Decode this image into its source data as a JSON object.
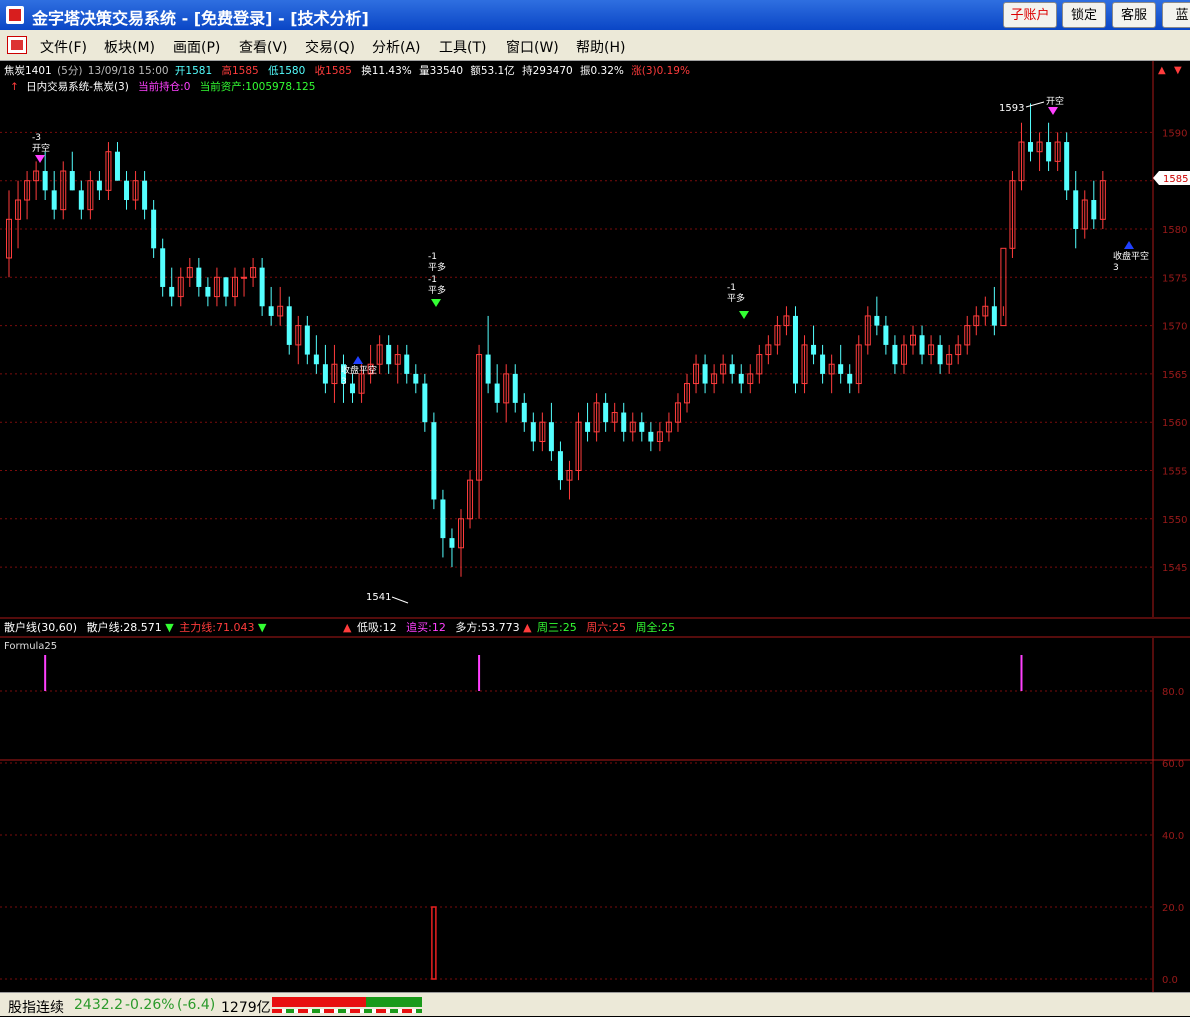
{
  "window": {
    "title": "金字塔决策交易系统 - [免费登录] - [技术分析]",
    "buttons": [
      "子账户",
      "锁定",
      "客服",
      "蓝"
    ]
  },
  "menu": {
    "items": [
      "文件(F)",
      "板块(M)",
      "画面(P)",
      "查看(V)",
      "交易(Q)",
      "分析(A)",
      "工具(T)",
      "窗口(W)",
      "帮助(H)"
    ]
  },
  "quote": {
    "symbol": "焦炭1401",
    "period": "(5分)",
    "datetime": "13/09/18 15:00",
    "open": "开1581",
    "high": "高1585",
    "low": "低1580",
    "close": "收1585",
    "turnover": "换11.43%",
    "volume": "量33540",
    "amount": "额53.1亿",
    "hold": "持293470",
    "amplitude": "振0.32%",
    "change": "涨(3)0.19%",
    "system": "日内交易系统-焦炭(3)",
    "position": "当前持仓:0",
    "assets": "当前资产:1005978.125",
    "current_price": "1585"
  },
  "axis": {
    "price_ticks": [
      "1590",
      "1585",
      "1580",
      "1575",
      "1570",
      "1565",
      "1560",
      "1555",
      "1550",
      "1545"
    ],
    "ind_ticks": [
      "80.0",
      "60.0",
      "40.0",
      "20.0",
      "0.0"
    ]
  },
  "markers": {
    "open_short_label": "开空",
    "open_short_count": "-3",
    "cover_label": "平多",
    "cover_count": "-1",
    "close_label": "收盘平空",
    "close_count": "3",
    "low_label": "1541",
    "high_label": "1593"
  },
  "indicator": {
    "name": "散户线(30,60)",
    "retail": "散户线:28.571",
    "main_force": "主力线:71.043",
    "low_buy": "低吸:12",
    "chase": "追买:12",
    "bull": "多方:53.773",
    "wed": "周三:25",
    "sat": "周六:25",
    "all": "周全:25"
  },
  "formula": {
    "name": "Formula25"
  },
  "status": {
    "index_name": "股指连续",
    "index_value": "2432.2",
    "index_change": "-0.26%",
    "index_delta": "(-6.4)",
    "index_volume": "1279亿"
  },
  "colors": {
    "up": "#ff3c3c",
    "down": "#54ffff",
    "grid": "#8a1010",
    "magenta": "#ff40ff"
  },
  "chart_data": {
    "type": "candlestick",
    "ylim": [
      1539,
      1596
    ],
    "candles": [
      [
        1577,
        1584,
        1575,
        1581
      ],
      [
        1581,
        1585,
        1578,
        1583
      ],
      [
        1583,
        1586,
        1581,
        1585
      ],
      [
        1585,
        1587,
        1583,
        1586
      ],
      [
        1586,
        1588,
        1583,
        1584
      ],
      [
        1584,
        1586,
        1581,
        1582
      ],
      [
        1582,
        1587,
        1581,
        1586
      ],
      [
        1586,
        1588,
        1584,
        1584
      ],
      [
        1584,
        1585,
        1581,
        1582
      ],
      [
        1582,
        1586,
        1581,
        1585
      ],
      [
        1585,
        1586,
        1583,
        1584
      ],
      [
        1584,
        1589,
        1583,
        1588
      ],
      [
        1588,
        1589,
        1585,
        1585
      ],
      [
        1585,
        1586,
        1582,
        1583
      ],
      [
        1583,
        1586,
        1582,
        1585
      ],
      [
        1585,
        1586,
        1581,
        1582
      ],
      [
        1582,
        1583,
        1577,
        1578
      ],
      [
        1578,
        1579,
        1573,
        1574
      ],
      [
        1574,
        1576,
        1572,
        1573
      ],
      [
        1573,
        1576,
        1572,
        1575
      ],
      [
        1575,
        1577,
        1574,
        1576
      ],
      [
        1576,
        1577,
        1573,
        1574
      ],
      [
        1574,
        1575,
        1572,
        1573
      ],
      [
        1573,
        1576,
        1572,
        1575
      ],
      [
        1575,
        1575,
        1572,
        1573
      ],
      [
        1573,
        1576,
        1572,
        1575
      ],
      [
        1575,
        1576,
        1573,
        1575
      ],
      [
        1575,
        1577,
        1574,
        1576
      ],
      [
        1576,
        1577,
        1571,
        1572
      ],
      [
        1572,
        1574,
        1570,
        1571
      ],
      [
        1571,
        1574,
        1570,
        1572
      ],
      [
        1572,
        1573,
        1567,
        1568
      ],
      [
        1568,
        1571,
        1566,
        1570
      ],
      [
        1570,
        1571,
        1566,
        1567
      ],
      [
        1567,
        1569,
        1565,
        1566
      ],
      [
        1566,
        1568,
        1563,
        1564
      ],
      [
        1564,
        1568,
        1562,
        1566
      ],
      [
        1566,
        1567,
        1562,
        1564
      ],
      [
        1564,
        1565,
        1562,
        1563
      ],
      [
        1563,
        1566,
        1562,
        1565
      ],
      [
        1565,
        1568,
        1564,
        1566
      ],
      [
        1566,
        1569,
        1565,
        1568
      ],
      [
        1568,
        1569,
        1565,
        1566
      ],
      [
        1566,
        1568,
        1564,
        1567
      ],
      [
        1567,
        1568,
        1564,
        1565
      ],
      [
        1565,
        1566,
        1563,
        1564
      ],
      [
        1564,
        1565,
        1559,
        1560
      ],
      [
        1560,
        1561,
        1551,
        1552
      ],
      [
        1552,
        1553,
        1546,
        1548
      ],
      [
        1548,
        1549,
        1545,
        1547
      ],
      [
        1547,
        1551,
        1544,
        1550
      ],
      [
        1550,
        1555,
        1549,
        1554
      ],
      [
        1554,
        1568,
        1550,
        1567
      ],
      [
        1567,
        1571,
        1563,
        1564
      ],
      [
        1564,
        1566,
        1561,
        1562
      ],
      [
        1562,
        1566,
        1560,
        1565
      ],
      [
        1565,
        1566,
        1561,
        1562
      ],
      [
        1562,
        1563,
        1559,
        1560
      ],
      [
        1560,
        1561,
        1557,
        1558
      ],
      [
        1558,
        1561,
        1557,
        1560
      ],
      [
        1560,
        1562,
        1556,
        1557
      ],
      [
        1557,
        1558,
        1553,
        1554
      ],
      [
        1554,
        1556,
        1552,
        1555
      ],
      [
        1555,
        1561,
        1554,
        1560
      ],
      [
        1560,
        1562,
        1558,
        1559
      ],
      [
        1559,
        1563,
        1558,
        1562
      ],
      [
        1562,
        1563,
        1559,
        1560
      ],
      [
        1560,
        1562,
        1559,
        1561
      ],
      [
        1561,
        1562,
        1558,
        1559
      ],
      [
        1559,
        1561,
        1558,
        1560
      ],
      [
        1560,
        1561,
        1558,
        1559
      ],
      [
        1559,
        1560,
        1557,
        1558
      ],
      [
        1558,
        1560,
        1557,
        1559
      ],
      [
        1559,
        1561,
        1558,
        1560
      ],
      [
        1560,
        1563,
        1559,
        1562
      ],
      [
        1562,
        1565,
        1561,
        1564
      ],
      [
        1564,
        1567,
        1563,
        1566
      ],
      [
        1566,
        1567,
        1563,
        1564
      ],
      [
        1564,
        1566,
        1563,
        1565
      ],
      [
        1565,
        1567,
        1564,
        1566
      ],
      [
        1566,
        1567,
        1564,
        1565
      ],
      [
        1565,
        1566,
        1563,
        1564
      ],
      [
        1564,
        1566,
        1563,
        1565
      ],
      [
        1565,
        1568,
        1564,
        1567
      ],
      [
        1567,
        1569,
        1566,
        1568
      ],
      [
        1568,
        1571,
        1567,
        1570
      ],
      [
        1570,
        1572,
        1569,
        1571
      ],
      [
        1571,
        1572,
        1563,
        1564
      ],
      [
        1564,
        1569,
        1563,
        1568
      ],
      [
        1568,
        1570,
        1566,
        1567
      ],
      [
        1567,
        1568,
        1564,
        1565
      ],
      [
        1565,
        1567,
        1563,
        1566
      ],
      [
        1566,
        1568,
        1564,
        1565
      ],
      [
        1565,
        1566,
        1563,
        1564
      ],
      [
        1564,
        1569,
        1563,
        1568
      ],
      [
        1568,
        1572,
        1567,
        1571
      ],
      [
        1571,
        1573,
        1569,
        1570
      ],
      [
        1570,
        1571,
        1567,
        1568
      ],
      [
        1568,
        1569,
        1565,
        1566
      ],
      [
        1566,
        1569,
        1565,
        1568
      ],
      [
        1568,
        1570,
        1567,
        1569
      ],
      [
        1569,
        1570,
        1566,
        1567
      ],
      [
        1567,
        1569,
        1566,
        1568
      ],
      [
        1568,
        1569,
        1565,
        1566
      ],
      [
        1566,
        1568,
        1565,
        1567
      ],
      [
        1567,
        1569,
        1566,
        1568
      ],
      [
        1568,
        1571,
        1567,
        1570
      ],
      [
        1570,
        1572,
        1569,
        1571
      ],
      [
        1571,
        1573,
        1570,
        1572
      ],
      [
        1572,
        1574,
        1569,
        1570
      ],
      [
        1570,
        1571,
        1572,
        1578
      ],
      [
        1578,
        1586,
        1577,
        1585
      ],
      [
        1585,
        1591,
        1584,
        1589
      ],
      [
        1589,
        1593,
        1587,
        1588
      ],
      [
        1588,
        1590,
        1586,
        1589
      ],
      [
        1589,
        1591,
        1586,
        1587
      ],
      [
        1587,
        1590,
        1586,
        1589
      ],
      [
        1589,
        1590,
        1583,
        1584
      ],
      [
        1584,
        1586,
        1578,
        1580
      ],
      [
        1580,
        1584,
        1579,
        1583
      ],
      [
        1583,
        1585,
        1580,
        1581
      ],
      [
        1581,
        1586,
        1580,
        1585
      ]
    ],
    "indicator_bars": [
      {
        "index": 4,
        "value": 80,
        "color": "magenta"
      },
      {
        "index": 52,
        "value": 80,
        "color": "magenta"
      },
      {
        "index": 112,
        "value": 80,
        "color": "magenta"
      },
      {
        "index": 47,
        "value": 20,
        "color": "red"
      }
    ]
  }
}
